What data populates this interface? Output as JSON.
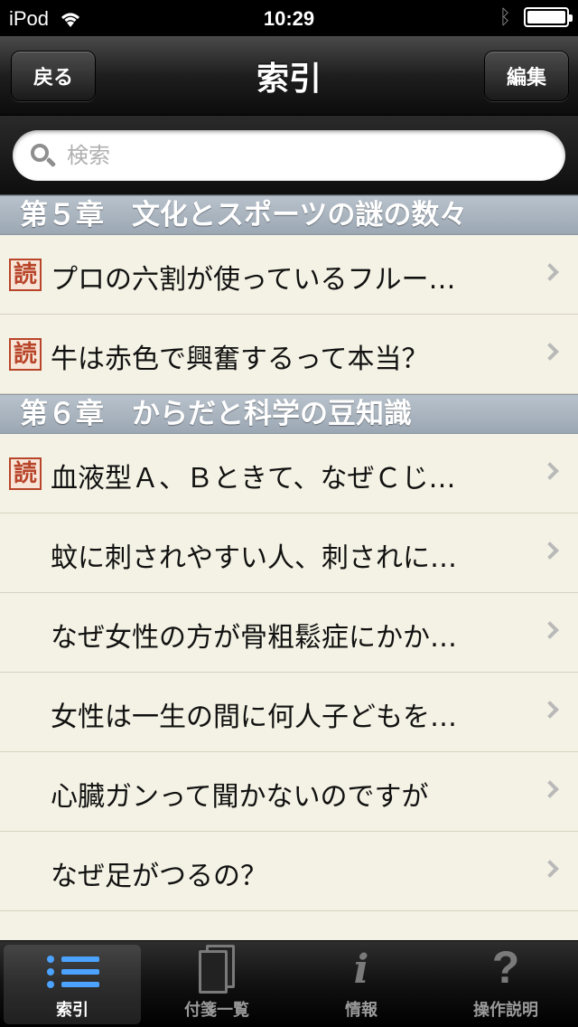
{
  "status": {
    "carrier": "iPod",
    "time": "10:29"
  },
  "nav": {
    "back_label": "戻る",
    "title": "索引",
    "edit_label": "編集"
  },
  "search": {
    "placeholder": "検索"
  },
  "sections": [
    {
      "title": "第５章　文化とスポーツの謎の数々",
      "rows": [
        {
          "text": "プロの六割が使っているフルー…",
          "read": true
        },
        {
          "text": "牛は赤色で興奮するって本当？",
          "read": true
        }
      ]
    },
    {
      "title": "第６章　からだと科学の豆知識",
      "rows": [
        {
          "text": "血液型Ａ、Ｂときて、なぜＣじ…",
          "read": true
        },
        {
          "text": "蚊に刺されやすい人、刺されに…",
          "read": false
        },
        {
          "text": "なぜ女性の方が骨粗鬆症にかか…",
          "read": false
        },
        {
          "text": "女性は一生の間に何人子どもを…",
          "read": false
        },
        {
          "text": "心臓ガンって聞かないのですが",
          "read": false
        },
        {
          "text": "なぜ足がつるの？",
          "read": false
        }
      ]
    }
  ],
  "read_badge_label": "読",
  "tabs": [
    {
      "label": "索引",
      "icon": "list-icon",
      "active": true
    },
    {
      "label": "付箋一覧",
      "icon": "pages-icon",
      "active": false
    },
    {
      "label": "情報",
      "icon": "info-icon",
      "active": false
    },
    {
      "label": "操作説明",
      "icon": "help-icon",
      "active": false
    }
  ],
  "colors": {
    "accent": "#4ba3ff",
    "read_badge": "#b8452a",
    "section_header": "#a9b4bf"
  }
}
